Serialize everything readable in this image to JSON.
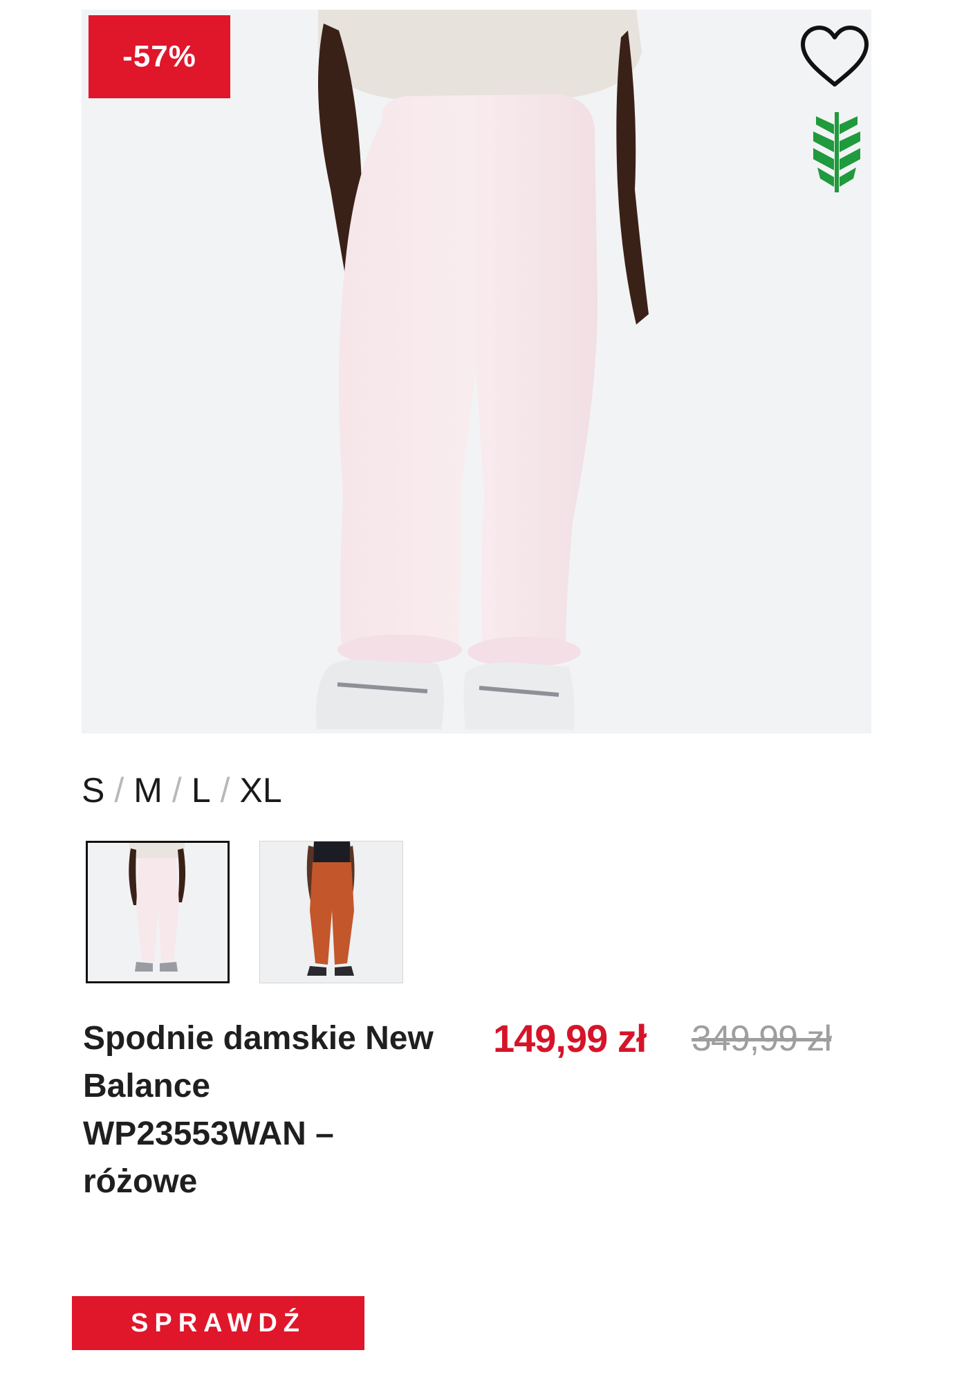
{
  "product": {
    "discount_badge": "-57%",
    "title": "Spodnie damskie New Balance WP23553WAN – różowe",
    "price_current": "149,99 zł",
    "price_old": "349,99 zł"
  },
  "sizes": [
    "S",
    "M",
    "L",
    "XL"
  ],
  "size_separator": "/",
  "color_variants": [
    {
      "name": "pink",
      "selected": true
    },
    {
      "name": "orange",
      "selected": false
    }
  ],
  "cta": {
    "label": "SPRAWDŹ"
  },
  "icons": {
    "wishlist": "heart-icon",
    "eco": "leaf-icon"
  },
  "colors": {
    "accent": "#e0162b",
    "price": "#d5142a",
    "old_price": "#9e9e9e",
    "eco": "#1f9a3c"
  }
}
